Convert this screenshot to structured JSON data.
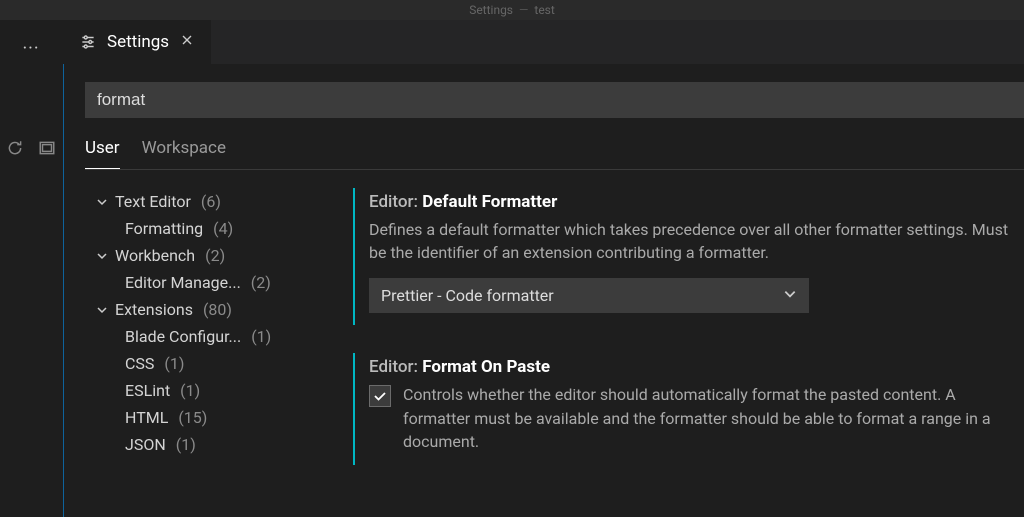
{
  "titlebar": {
    "left": "Settings",
    "right": "test"
  },
  "tab": {
    "label": "Settings"
  },
  "search": {
    "value": "format"
  },
  "scopes": {
    "user": "User",
    "workspace": "Workspace"
  },
  "toc": {
    "textEditor": {
      "label": "Text Editor",
      "count": "(6)"
    },
    "formatting": {
      "label": "Formatting",
      "count": "(4)"
    },
    "workbench": {
      "label": "Workbench",
      "count": "(2)"
    },
    "editorManage": {
      "label": "Editor Manage...",
      "count": "(2)"
    },
    "extensions": {
      "label": "Extensions",
      "count": "(80)"
    },
    "blade": {
      "label": "Blade Configur...",
      "count": "(1)"
    },
    "css": {
      "label": "CSS",
      "count": "(1)"
    },
    "eslint": {
      "label": "ESLint",
      "count": "(1)"
    },
    "html": {
      "label": "HTML",
      "count": "(15)"
    },
    "json": {
      "label": "JSON",
      "count": "(1)"
    }
  },
  "settings": {
    "defaultFormatter": {
      "scope": "Editor:",
      "name": "Default Formatter",
      "desc": "Defines a default formatter which takes precedence over all other formatter settings. Must be the identifier of an extension contributing a formatter.",
      "value": "Prettier - Code formatter"
    },
    "formatOnPaste": {
      "scope": "Editor:",
      "name": "Format On Paste",
      "desc": "Controls whether the editor should automatically format the pasted content. A formatter must be available and the formatter should be able to format a range in a document."
    }
  }
}
